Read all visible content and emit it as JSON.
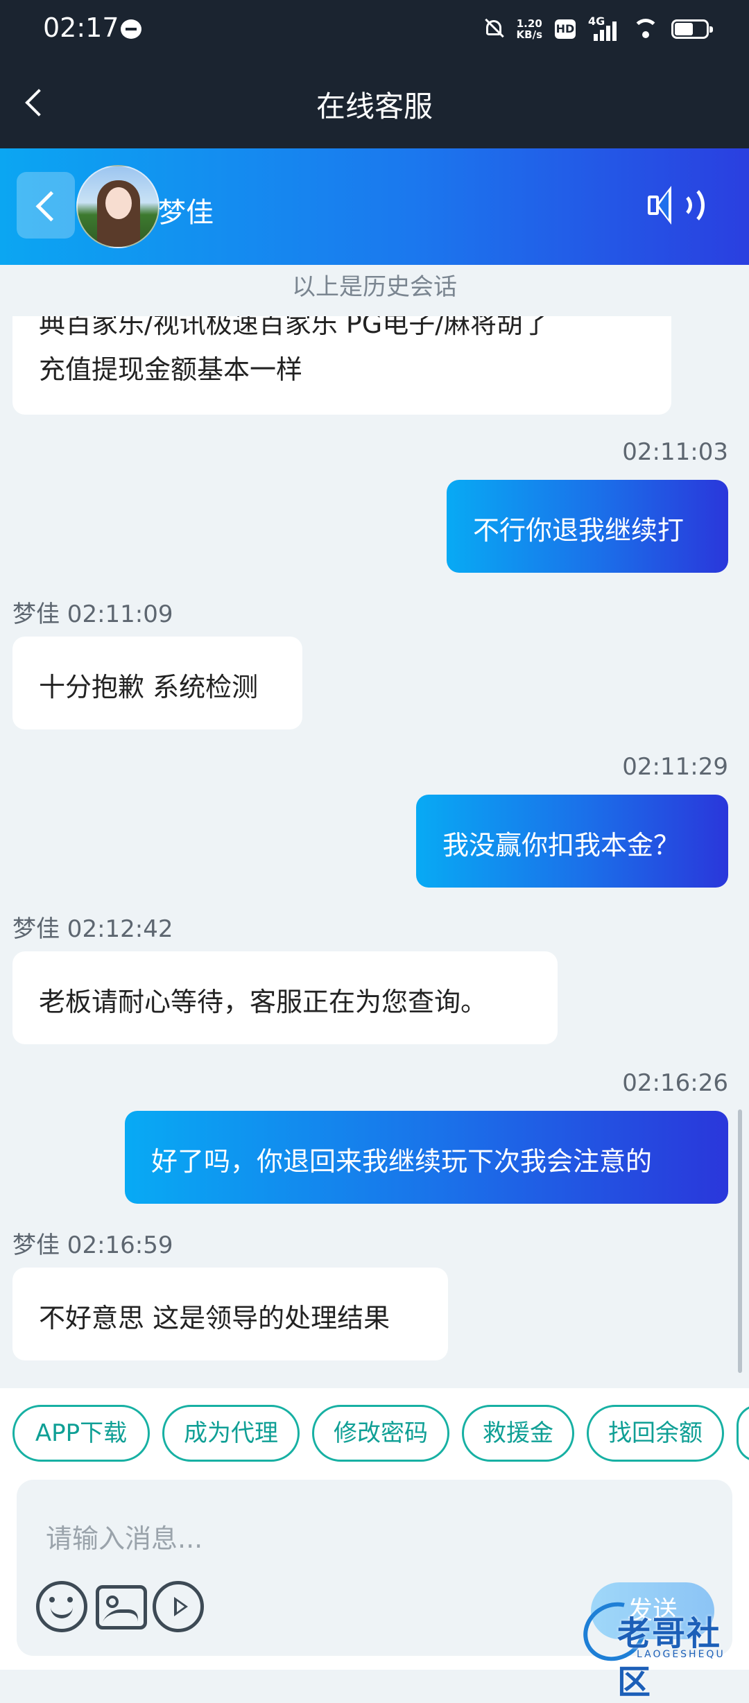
{
  "status_bar": {
    "time": "02:17",
    "net_speed_top": "1.20",
    "net_speed_bottom": "KB/s",
    "hd": "HD",
    "network": "4G"
  },
  "nav": {
    "title": "在线客服"
  },
  "chat_header": {
    "agent_name": "梦佳"
  },
  "history_note": "以上是历史会话",
  "messages": [
    {
      "side": "left",
      "lines": [
        "典百家乐/视讯极速百家乐  PG电子/麻将胡了",
        "充值提现金额基本一样"
      ]
    },
    {
      "side": "right",
      "time": "02:11:03",
      "text": "不行你退我继续打"
    },
    {
      "side": "left",
      "meta": "梦佳 02:11:09",
      "text": "十分抱歉 系统检测"
    },
    {
      "side": "right",
      "time": "02:11:29",
      "text": "我没赢你扣我本金？"
    },
    {
      "side": "left",
      "meta": "梦佳 02:12:42",
      "text": "老板请耐心等待，客服正在为您查询。"
    },
    {
      "side": "right",
      "time": "02:16:26",
      "text": "好了吗，你退回来我继续玩下次我会注意的"
    },
    {
      "side": "left",
      "meta": "梦佳 02:16:59",
      "text": "不好意思 这是领导的处理结果"
    }
  ],
  "quick_chips": [
    "APP下载",
    "成为代理",
    "修改密码",
    "救援金",
    "找回余额"
  ],
  "composer": {
    "placeholder": "请输入消息...",
    "send_label": "发送"
  },
  "watermark": {
    "text": "老哥社区",
    "sub": "LAOGESHEQU"
  },
  "colors": {
    "header_gradient_start": "#0ba6f2",
    "header_gradient_end": "#2a3fe0",
    "chip_border": "#17b0a3",
    "topbar_bg": "#1b2430"
  }
}
